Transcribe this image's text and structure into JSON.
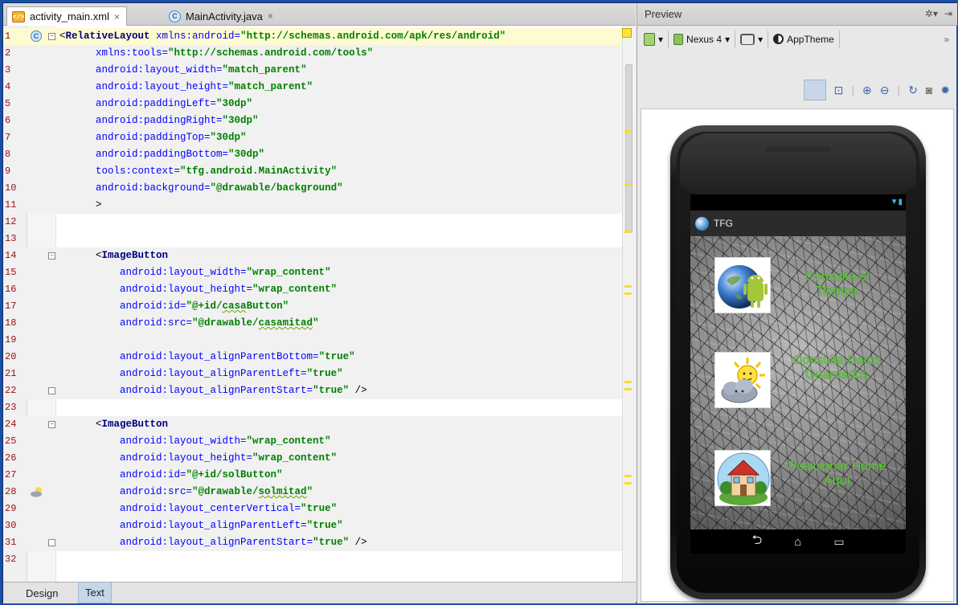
{
  "editor": {
    "tabs": [
      {
        "label": "activity_main.xml",
        "close": "×",
        "icon": "xml-file-icon"
      },
      {
        "label": "MainActivity.java",
        "close": "×",
        "icon": "java-class-icon"
      }
    ],
    "lines": [
      {
        "n": "1",
        "parts": [
          [
            "punct",
            "<"
          ],
          [
            "tag",
            "RelativeLayout "
          ],
          [
            "attr",
            "xmlns:android="
          ],
          [
            "val",
            "\"http://schemas.android.com/apk/res/android\""
          ]
        ]
      },
      {
        "n": "2",
        "parts": [
          [
            "sp",
            "      "
          ],
          [
            "attr",
            "xmlns:tools="
          ],
          [
            "val",
            "\"http://schemas.android.com/tools\""
          ]
        ]
      },
      {
        "n": "3",
        "parts": [
          [
            "sp",
            "      "
          ],
          [
            "attr",
            "android:layout_width="
          ],
          [
            "val",
            "\"match_parent\""
          ]
        ]
      },
      {
        "n": "4",
        "parts": [
          [
            "sp",
            "      "
          ],
          [
            "attr",
            "android:layout_height="
          ],
          [
            "val",
            "\"match_parent\""
          ]
        ]
      },
      {
        "n": "5",
        "parts": [
          [
            "sp",
            "      "
          ],
          [
            "attr",
            "android:paddingLeft="
          ],
          [
            "val",
            "\"30dp\""
          ]
        ]
      },
      {
        "n": "6",
        "parts": [
          [
            "sp",
            "      "
          ],
          [
            "attr",
            "android:paddingRight="
          ],
          [
            "val",
            "\"30dp\""
          ]
        ]
      },
      {
        "n": "7",
        "parts": [
          [
            "sp",
            "      "
          ],
          [
            "attr",
            "android:paddingTop="
          ],
          [
            "val",
            "\"30dp\""
          ]
        ]
      },
      {
        "n": "8",
        "parts": [
          [
            "sp",
            "      "
          ],
          [
            "attr",
            "android:paddingBottom="
          ],
          [
            "val",
            "\"30dp\""
          ]
        ]
      },
      {
        "n": "9",
        "parts": [
          [
            "sp",
            "      "
          ],
          [
            "attr",
            "tools:context="
          ],
          [
            "val",
            "\"tfg.android.MainActivity\""
          ]
        ]
      },
      {
        "n": "10",
        "parts": [
          [
            "sp",
            "      "
          ],
          [
            "attr",
            "android:background="
          ],
          [
            "val",
            "\"@drawable/background\""
          ]
        ]
      },
      {
        "n": "11",
        "parts": [
          [
            "sp",
            "      "
          ],
          [
            "punct",
            ">"
          ]
        ]
      },
      {
        "n": "12",
        "parts": []
      },
      {
        "n": "13",
        "parts": []
      },
      {
        "n": "14",
        "parts": [
          [
            "sp",
            "      "
          ],
          [
            "punct",
            "<"
          ],
          [
            "tag",
            "ImageButton"
          ]
        ]
      },
      {
        "n": "15",
        "parts": [
          [
            "sp",
            "          "
          ],
          [
            "attr",
            "android:layout_width="
          ],
          [
            "val",
            "\"wrap_content\""
          ]
        ]
      },
      {
        "n": "16",
        "parts": [
          [
            "sp",
            "          "
          ],
          [
            "attr",
            "android:layout_height="
          ],
          [
            "val",
            "\"wrap_content\""
          ]
        ]
      },
      {
        "n": "17",
        "parts": [
          [
            "sp",
            "          "
          ],
          [
            "attr",
            "android:id="
          ],
          [
            "val",
            "\"@+id/"
          ],
          [
            "valsq",
            "casa"
          ],
          [
            "val",
            "Button\""
          ]
        ]
      },
      {
        "n": "18",
        "parts": [
          [
            "sp",
            "          "
          ],
          [
            "attr",
            "android:src="
          ],
          [
            "val",
            "\"@drawable/"
          ],
          [
            "valsq",
            "casamitad"
          ],
          [
            "val",
            "\""
          ]
        ]
      },
      {
        "n": "19",
        "parts": []
      },
      {
        "n": "20",
        "parts": [
          [
            "sp",
            "          "
          ],
          [
            "attr",
            "android:layout_alignParentBottom="
          ],
          [
            "val",
            "\"true\""
          ]
        ]
      },
      {
        "n": "21",
        "parts": [
          [
            "sp",
            "          "
          ],
          [
            "attr",
            "android:layout_alignParentLeft="
          ],
          [
            "val",
            "\"true\""
          ]
        ]
      },
      {
        "n": "22",
        "parts": [
          [
            "sp",
            "          "
          ],
          [
            "attr",
            "android:layout_alignParentStart="
          ],
          [
            "val",
            "\"true\""
          ],
          [
            "punct",
            " />"
          ]
        ]
      },
      {
        "n": "23",
        "parts": []
      },
      {
        "n": "24",
        "parts": [
          [
            "sp",
            "      "
          ],
          [
            "punct",
            "<"
          ],
          [
            "tag",
            "ImageButton"
          ]
        ]
      },
      {
        "n": "25",
        "parts": [
          [
            "sp",
            "          "
          ],
          [
            "attr",
            "android:layout_width="
          ],
          [
            "val",
            "\"wrap_content\""
          ]
        ]
      },
      {
        "n": "26",
        "parts": [
          [
            "sp",
            "          "
          ],
          [
            "attr",
            "android:layout_height="
          ],
          [
            "val",
            "\"wrap_content\""
          ]
        ]
      },
      {
        "n": "27",
        "parts": [
          [
            "sp",
            "          "
          ],
          [
            "attr",
            "android:id="
          ],
          [
            "val",
            "\"@+id/solButton\""
          ]
        ]
      },
      {
        "n": "28",
        "parts": [
          [
            "sp",
            "          "
          ],
          [
            "attr",
            "android:src="
          ],
          [
            "val",
            "\"@drawable/"
          ],
          [
            "valsq",
            "solmitad"
          ],
          [
            "val",
            "\""
          ]
        ]
      },
      {
        "n": "29",
        "parts": [
          [
            "sp",
            "          "
          ],
          [
            "attr",
            "android:layout_centerVertical="
          ],
          [
            "val",
            "\"true\""
          ]
        ]
      },
      {
        "n": "30",
        "parts": [
          [
            "sp",
            "          "
          ],
          [
            "attr",
            "android:layout_alignParentLeft="
          ],
          [
            "val",
            "\"true\""
          ]
        ]
      },
      {
        "n": "31",
        "parts": [
          [
            "sp",
            "          "
          ],
          [
            "attr",
            "android:layout_alignParentStart="
          ],
          [
            "val",
            "\"true\""
          ],
          [
            "punct",
            " />"
          ]
        ]
      },
      {
        "n": "32",
        "parts": []
      }
    ],
    "bottom_tabs": [
      "Design",
      "Text"
    ],
    "active_bottom_tab": "Text"
  },
  "preview": {
    "title": "Preview",
    "device": "Nexus 4",
    "theme": "AppTheme",
    "overflow": "»",
    "app": {
      "title": "TFG",
      "buttons": [
        {
          "label": "Consulta el Tiempo",
          "icon": "globe-android-icon"
        },
        {
          "label": "Consulta Datos Guardados",
          "icon": "sun-cloud-icon"
        },
        {
          "label": "Posicionar Home Aquí",
          "icon": "house-icon"
        }
      ]
    }
  }
}
